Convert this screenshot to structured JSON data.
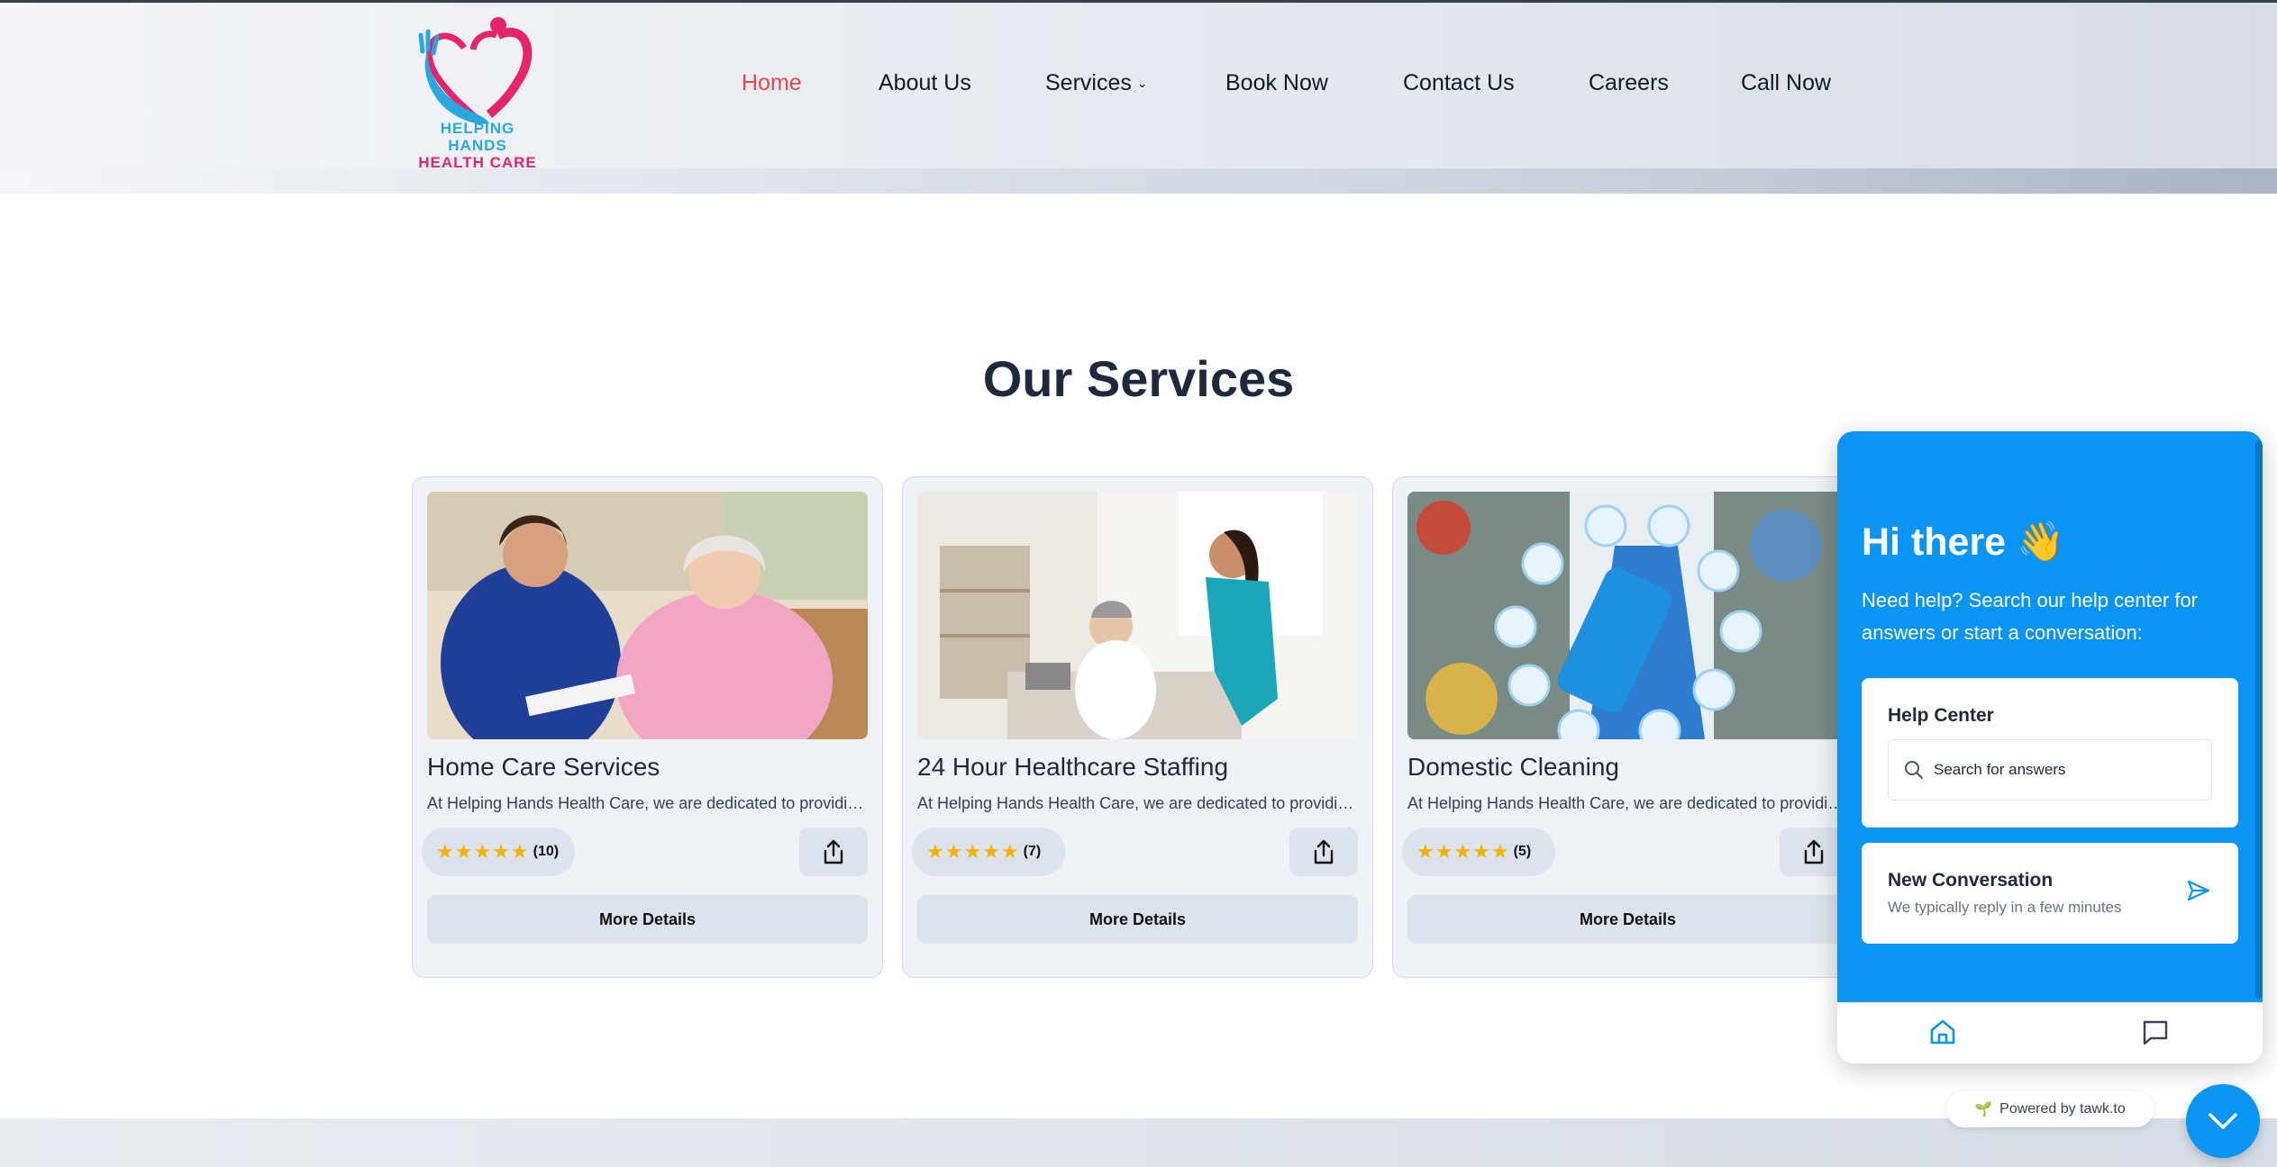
{
  "brand": {
    "line1": "HELPING HANDS",
    "line2": "HEALTH CARE",
    "colors": {
      "blue": "#29a8e0",
      "pink": "#e6246b"
    }
  },
  "nav": {
    "items": [
      {
        "label": "Home",
        "active": true
      },
      {
        "label": "About Us"
      },
      {
        "label": "Services",
        "has_dropdown": true,
        "chevron": "⌄"
      },
      {
        "label": "Book Now"
      },
      {
        "label": "Contact Us"
      },
      {
        "label": "Careers"
      },
      {
        "label": "Call Now"
      }
    ],
    "active_color": "#e24a4a"
  },
  "section": {
    "title": "Our Services"
  },
  "cards": [
    {
      "title": "Home Care Services",
      "desc": "At Helping Hands Health Care, we are dedicated to providing compassionate home care",
      "stars": "★★★★★",
      "count": "(10)",
      "more": "More Details"
    },
    {
      "title": "24 Hour Healthcare Staffing",
      "desc": "At Helping Hands Health Care, we are dedicated to providing reliable healthcare staffing",
      "stars": "★★★★★",
      "count": "(7)",
      "more": "More Details"
    },
    {
      "title": "Domestic Cleaning",
      "desc": "At Helping Hands Health Care, we are dedicated to providing domestic cleaning",
      "stars": "★★★★★",
      "count": "(5)",
      "more": "More Details"
    }
  ],
  "chat": {
    "greeting": "Hi there 👋",
    "subtitle": "Need help? Search our help center for answers or start a conversation:",
    "help_center": {
      "title": "Help Center",
      "placeholder": "Search for answers"
    },
    "new_conversation": {
      "title": "New Conversation",
      "subtitle": "We typically reply in a few minutes"
    },
    "powered_by": "Powered by tawk.to",
    "accent": "#0a95f5"
  }
}
